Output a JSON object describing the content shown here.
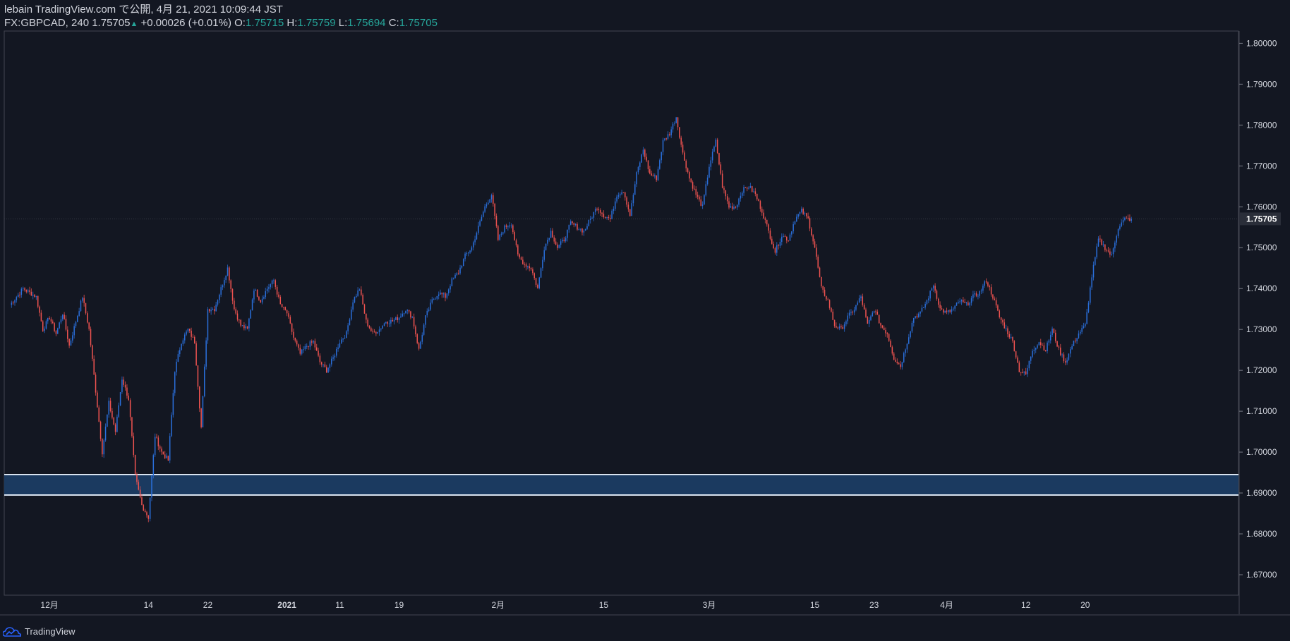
{
  "header": {
    "publisher_line": "lebain TradingView.com で公開, 4月 21, 2021 10:09:44 JST",
    "symbol": "FX:GBPCAD, 240",
    "last": "1.75705",
    "change": "+0.00026 (+0.01%)",
    "o_label": "O:",
    "o_value": "1.75715",
    "h_label": "H:",
    "h_value": "1.75759",
    "l_label": "L:",
    "l_value": "1.75694",
    "c_label": "C:",
    "c_value": "1.75705"
  },
  "footer": {
    "brand": "TradingView"
  },
  "colors": {
    "background": "#131722",
    "up": "#2a6fdb",
    "down": "#ef5350",
    "zone": "#1b3a60",
    "zone_border": "#d9e3f0",
    "axis_text": "#d1d4dc"
  },
  "chart_data": {
    "type": "candlestick",
    "symbol": "FX:GBPCAD",
    "timeframe": "240",
    "ylim": [
      1.665,
      1.803
    ],
    "y_ticks": [
      "1.67000",
      "1.68000",
      "1.69000",
      "1.70000",
      "1.71000",
      "1.72000",
      "1.73000",
      "1.74000",
      "1.75000",
      "1.76000",
      "1.77000",
      "1.78000",
      "1.79000",
      "1.80000"
    ],
    "x_ticks": [
      {
        "label": "12月",
        "t": 6
      },
      {
        "label": "14",
        "t": 21
      },
      {
        "label": "22",
        "t": 30
      },
      {
        "label": "2021",
        "t": 42
      },
      {
        "label": "11",
        "t": 50
      },
      {
        "label": "19",
        "t": 59
      },
      {
        "label": "2月",
        "t": 74
      },
      {
        "label": "15",
        "t": 90
      },
      {
        "label": "3月",
        "t": 106
      },
      {
        "label": "15",
        "t": 122
      },
      {
        "label": "23",
        "t": 131
      },
      {
        "label": "4月",
        "t": 142
      },
      {
        "label": "12",
        "t": 154
      },
      {
        "label": "20",
        "t": 163
      }
    ],
    "t_range": [
      0,
      175
    ],
    "price_label": "1.75705",
    "last_price": 1.75705,
    "zone": {
      "low": 1.6895,
      "high": 1.6945
    },
    "path": [
      [
        0,
        1.736
      ],
      [
        2,
        1.74
      ],
      [
        4,
        1.738
      ],
      [
        5,
        1.73
      ],
      [
        6,
        1.733
      ],
      [
        7,
        1.729
      ],
      [
        8,
        1.734
      ],
      [
        9,
        1.726
      ],
      [
        11,
        1.738
      ],
      [
        12,
        1.73
      ],
      [
        13,
        1.715
      ],
      [
        14,
        1.7
      ],
      [
        15,
        1.712
      ],
      [
        16,
        1.705
      ],
      [
        17,
        1.718
      ],
      [
        18,
        1.713
      ],
      [
        19,
        1.694
      ],
      [
        20,
        1.687
      ],
      [
        21,
        1.684
      ],
      [
        22,
        1.704
      ],
      [
        23,
        1.7
      ],
      [
        24,
        1.698
      ],
      [
        25,
        1.72
      ],
      [
        26,
        1.727
      ],
      [
        27,
        1.73
      ],
      [
        28,
        1.727
      ],
      [
        29,
        1.706
      ],
      [
        30,
        1.735
      ],
      [
        31,
        1.735
      ],
      [
        32,
        1.74
      ],
      [
        33,
        1.745
      ],
      [
        34,
        1.735
      ],
      [
        35,
        1.731
      ],
      [
        36,
        1.73
      ],
      [
        37,
        1.74
      ],
      [
        38,
        1.737
      ],
      [
        39,
        1.74
      ],
      [
        40,
        1.742
      ],
      [
        41,
        1.736
      ],
      [
        42,
        1.734
      ],
      [
        43,
        1.728
      ],
      [
        44,
        1.724
      ],
      [
        45,
        1.726
      ],
      [
        46,
        1.727
      ],
      [
        47,
        1.722
      ],
      [
        48,
        1.72
      ],
      [
        49,
        1.723
      ],
      [
        50,
        1.727
      ],
      [
        51,
        1.729
      ],
      [
        52,
        1.737
      ],
      [
        53,
        1.74
      ],
      [
        54,
        1.732
      ],
      [
        55,
        1.729
      ],
      [
        56,
        1.73
      ],
      [
        57,
        1.732
      ],
      [
        58,
        1.732
      ],
      [
        59,
        1.733
      ],
      [
        60,
        1.735
      ],
      [
        61,
        1.733
      ],
      [
        62,
        1.725
      ],
      [
        63,
        1.733
      ],
      [
        64,
        1.737
      ],
      [
        65,
        1.739
      ],
      [
        66,
        1.738
      ],
      [
        67,
        1.742
      ],
      [
        68,
        1.744
      ],
      [
        69,
        1.748
      ],
      [
        70,
        1.75
      ],
      [
        71,
        1.755
      ],
      [
        72,
        1.76
      ],
      [
        73,
        1.763
      ],
      [
        74,
        1.752
      ],
      [
        75,
        1.755
      ],
      [
        76,
        1.756
      ],
      [
        77,
        1.748
      ],
      [
        78,
        1.746
      ],
      [
        79,
        1.745
      ],
      [
        80,
        1.74
      ],
      [
        81,
        1.75
      ],
      [
        82,
        1.754
      ],
      [
        83,
        1.75
      ],
      [
        84,
        1.752
      ],
      [
        85,
        1.756
      ],
      [
        86,
        1.755
      ],
      [
        87,
        1.754
      ],
      [
        88,
        1.757
      ],
      [
        89,
        1.76
      ],
      [
        90,
        1.758
      ],
      [
        91,
        1.757
      ],
      [
        92,
        1.763
      ],
      [
        93,
        1.764
      ],
      [
        94,
        1.758
      ],
      [
        95,
        1.768
      ],
      [
        96,
        1.774
      ],
      [
        97,
        1.768
      ],
      [
        98,
        1.767
      ],
      [
        99,
        1.776
      ],
      [
        100,
        1.778
      ],
      [
        101,
        1.782
      ],
      [
        102,
        1.773
      ],
      [
        103,
        1.767
      ],
      [
        104,
        1.763
      ],
      [
        105,
        1.76
      ],
      [
        106,
        1.77
      ],
      [
        107,
        1.776
      ],
      [
        108,
        1.765
      ],
      [
        109,
        1.76
      ],
      [
        110,
        1.76
      ],
      [
        111,
        1.764
      ],
      [
        112,
        1.765
      ],
      [
        113,
        1.763
      ],
      [
        114,
        1.759
      ],
      [
        115,
        1.754
      ],
      [
        116,
        1.749
      ],
      [
        117,
        1.753
      ],
      [
        118,
        1.752
      ],
      [
        119,
        1.757
      ],
      [
        120,
        1.759
      ],
      [
        121,
        1.757
      ],
      [
        122,
        1.75
      ],
      [
        123,
        1.74
      ],
      [
        124,
        1.737
      ],
      [
        125,
        1.731
      ],
      [
        126,
        1.73
      ],
      [
        127,
        1.733
      ],
      [
        128,
        1.735
      ],
      [
        129,
        1.738
      ],
      [
        130,
        1.731
      ],
      [
        131,
        1.735
      ],
      [
        132,
        1.731
      ],
      [
        133,
        1.729
      ],
      [
        134,
        1.723
      ],
      [
        135,
        1.721
      ],
      [
        136,
        1.727
      ],
      [
        137,
        1.733
      ],
      [
        138,
        1.734
      ],
      [
        139,
        1.737
      ],
      [
        140,
        1.741
      ],
      [
        141,
        1.735
      ],
      [
        142,
        1.734
      ],
      [
        143,
        1.735
      ],
      [
        144,
        1.737
      ],
      [
        145,
        1.736
      ],
      [
        146,
        1.738
      ],
      [
        147,
        1.739
      ],
      [
        148,
        1.742
      ],
      [
        149,
        1.738
      ],
      [
        150,
        1.733
      ],
      [
        151,
        1.73
      ],
      [
        152,
        1.727
      ],
      [
        153,
        1.72
      ],
      [
        154,
        1.719
      ],
      [
        155,
        1.725
      ],
      [
        156,
        1.727
      ],
      [
        157,
        1.725
      ],
      [
        158,
        1.73
      ],
      [
        159,
        1.725
      ],
      [
        160,
        1.722
      ],
      [
        161,
        1.726
      ],
      [
        162,
        1.729
      ],
      [
        163,
        1.731
      ],
      [
        164,
        1.743
      ],
      [
        165,
        1.752
      ],
      [
        166,
        1.75
      ],
      [
        167,
        1.748
      ],
      [
        168,
        1.755
      ],
      [
        169,
        1.757
      ],
      [
        170,
        1.757
      ]
    ]
  }
}
